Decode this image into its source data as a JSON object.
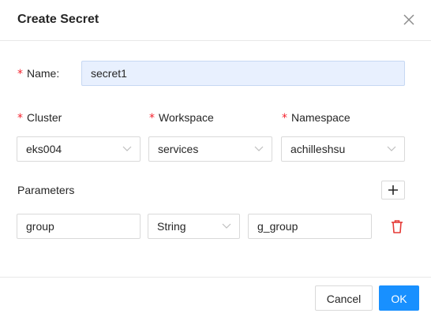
{
  "dialog": {
    "title": "Create Secret"
  },
  "form": {
    "name_label": "Name:",
    "name_value": "secret1",
    "cluster_label": "Cluster",
    "cluster_value": "eks004",
    "workspace_label": "Workspace",
    "workspace_value": "services",
    "namespace_label": "Namespace",
    "namespace_value": "achilleshsu",
    "required_mark": "*"
  },
  "parameters": {
    "label": "Parameters",
    "rows": [
      {
        "key": "group",
        "type": "String",
        "value": "g_group"
      }
    ]
  },
  "footer": {
    "cancel_label": "Cancel",
    "ok_label": "OK"
  },
  "colors": {
    "primary": "#1890ff",
    "required": "#f5222d",
    "danger": "#e53935"
  },
  "icons": {
    "close": "close-icon",
    "chevron": "chevron-down-icon",
    "add": "plus-icon",
    "delete": "trash-icon"
  }
}
